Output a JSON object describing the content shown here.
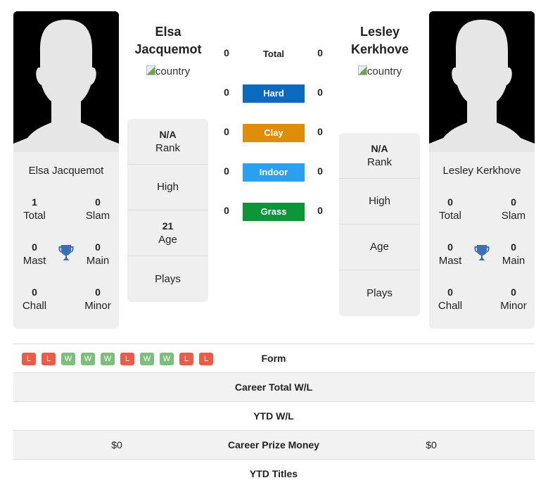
{
  "players": {
    "left": {
      "name": "Elsa Jacquemot",
      "header_name_line1": "Elsa",
      "header_name_line2": "Jacquemot",
      "country_alt": "country",
      "titles": {
        "total": {
          "value": "1",
          "label": "Total"
        },
        "slam": {
          "value": "0",
          "label": "Slam"
        },
        "mast": {
          "value": "0",
          "label": "Mast"
        },
        "main": {
          "value": "0",
          "label": "Main"
        },
        "chall": {
          "value": "0",
          "label": "Chall"
        },
        "minor": {
          "value": "0",
          "label": "Minor"
        }
      },
      "info": {
        "rank": {
          "value": "N/A",
          "label": "Rank"
        },
        "high": {
          "value": "",
          "label": "High"
        },
        "age": {
          "value": "21",
          "label": "Age"
        },
        "plays": {
          "value": "",
          "label": "Plays"
        }
      }
    },
    "right": {
      "name": "Lesley Kerkhove",
      "header_name_line1": "Lesley",
      "header_name_line2": "Kerkhove",
      "country_alt": "country",
      "titles": {
        "total": {
          "value": "0",
          "label": "Total"
        },
        "slam": {
          "value": "0",
          "label": "Slam"
        },
        "mast": {
          "value": "0",
          "label": "Mast"
        },
        "main": {
          "value": "0",
          "label": "Main"
        },
        "chall": {
          "value": "0",
          "label": "Chall"
        },
        "minor": {
          "value": "0",
          "label": "Minor"
        }
      },
      "info": {
        "rank": {
          "value": "N/A",
          "label": "Rank"
        },
        "high": {
          "value": "",
          "label": "High"
        },
        "age": {
          "value": "",
          "label": "Age"
        },
        "plays": {
          "value": "",
          "label": "Plays"
        }
      }
    }
  },
  "h2h": {
    "total": {
      "label": "Total",
      "left": "0",
      "right": "0"
    },
    "surfaces": [
      {
        "label": "Hard",
        "left": "0",
        "right": "0",
        "color": "#0a6ac0"
      },
      {
        "label": "Clay",
        "left": "0",
        "right": "0",
        "color": "#de8c0a"
      },
      {
        "label": "Indoor",
        "left": "0",
        "right": "0",
        "color": "#2b9ff0"
      },
      {
        "label": "Grass",
        "left": "0",
        "right": "0",
        "color": "#0d953a"
      }
    ]
  },
  "comparison": {
    "form": {
      "label": "Form",
      "left": [
        "L",
        "L",
        "W",
        "W",
        "W",
        "L",
        "W",
        "W",
        "L",
        "L"
      ]
    },
    "rows": [
      {
        "label": "Career Total W/L",
        "left": "",
        "right": ""
      },
      {
        "label": "YTD W/L",
        "left": "",
        "right": ""
      },
      {
        "label": "Career Prize Money",
        "left": "$0",
        "right": "$0"
      },
      {
        "label": "YTD Titles",
        "left": "",
        "right": ""
      }
    ]
  }
}
